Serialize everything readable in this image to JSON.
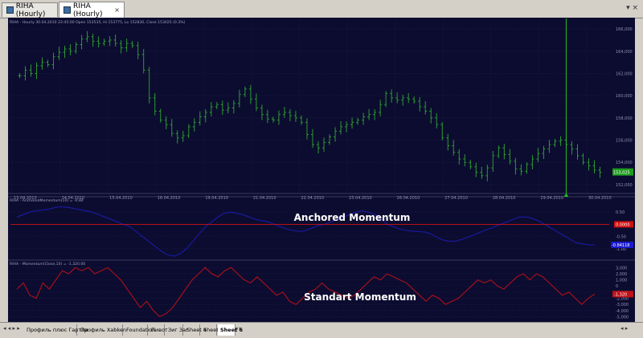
{
  "tabs": [
    {
      "label": "RIHA (Hourly)",
      "active": false
    },
    {
      "label": "RIHA (Hourly)",
      "active": true
    }
  ],
  "window_controls": "▾ ×",
  "colors": {
    "background": "#0c0c30",
    "grid": "#1e2450",
    "price_bar": "#2fa82f",
    "momentum_anchored": "#1a1aa8",
    "momentum_standard": "#b01018",
    "zero_line": "#d01010",
    "cursor_line": "#22c022",
    "axis_text": "#9090b0"
  },
  "chart_data": [
    {
      "type": "line",
      "title": "RIHA - Hourly 30.04.2010 23:45:00 Open 153535, Hi 153775, Lo 152830, Close 153025 (0.3%)",
      "xlabel": "",
      "ylabel": "",
      "x_ticks": [
        "13.04.2010",
        "14.04.2010",
        "15.04.2010",
        "16.04.2010",
        "19.04.2010",
        "21.04.2010",
        "22.04.2010",
        "23.04.2010",
        "26.04.2010",
        "27.04.2010",
        "28.04.2010",
        "29.04.2010",
        "30.04.2010"
      ],
      "y_ticks": [
        152000,
        154000,
        156000,
        158000,
        160000,
        162000,
        164000,
        166000
      ],
      "y_tick_labels": [
        "152,000",
        "154,000",
        "156,000",
        "158,000",
        "160,000",
        "162,000",
        "164,000",
        "166,000"
      ],
      "ylim": [
        151200,
        166800
      ],
      "series": [
        {
          "values": [
            161800,
            162300,
            162000,
            162700,
            163000,
            162800,
            163500,
            163900,
            164200,
            164000,
            164600,
            165100,
            165300,
            164900,
            164700,
            164900,
            165000,
            164700,
            164300,
            164700,
            164500,
            163700,
            162300,
            159800,
            158600,
            157800,
            157400,
            156600,
            156200,
            156400,
            157200,
            157600,
            158100,
            158500,
            159000,
            159200,
            158700,
            158900,
            159300,
            160100,
            160600,
            159700,
            158900,
            158300,
            157900,
            157800,
            158300,
            158500,
            158200,
            158000,
            157600,
            156500,
            155600,
            155300,
            155800,
            156300,
            156800,
            157200,
            157400,
            157600,
            157800,
            158100,
            158300,
            158500,
            159200,
            160200,
            159800,
            159600,
            159800,
            159700,
            159500,
            159000,
            158600,
            158000,
            157400,
            156200,
            155500,
            154900,
            154300,
            154000,
            153600,
            153100,
            152800,
            153500,
            154600,
            155300,
            154700,
            154100,
            153400,
            153200,
            153800,
            154300,
            154800,
            155200,
            155600,
            155900,
            156000,
            155600,
            155200,
            154600,
            154000,
            153700,
            153300,
            153100
          ]
        }
      ],
      "last_label": "153,025",
      "cursor_index": 97
    },
    {
      "type": "line",
      "title": "RIHA - AnchoredMomentum(10) = -0.84",
      "annotation": "Anchored Momentum",
      "y_ticks": [
        -1,
        -0.5,
        0,
        0.5
      ],
      "y_tick_labels": [
        "-1.00",
        "-0.50",
        "0.00",
        "0.50"
      ],
      "ylim": [
        -1.4,
        1.0
      ],
      "zero_label": "0.0000",
      "last_label": "-0.84118",
      "series": [
        {
          "values": [
            0.3,
            0.4,
            0.5,
            0.55,
            0.58,
            0.62,
            0.68,
            0.72,
            0.7,
            0.65,
            0.6,
            0.55,
            0.5,
            0.4,
            0.3,
            0.2,
            0.1,
            0.0,
            -0.1,
            -0.3,
            -0.5,
            -0.7,
            -0.9,
            -1.1,
            -1.25,
            -1.3,
            -1.2,
            -1.0,
            -0.7,
            -0.4,
            -0.1,
            0.1,
            0.3,
            0.45,
            0.5,
            0.45,
            0.4,
            0.3,
            0.2,
            0.15,
            0.1,
            0.0,
            -0.1,
            -0.2,
            -0.25,
            -0.3,
            -0.25,
            -0.15,
            -0.05,
            0.0,
            0.1,
            0.2,
            0.3,
            0.4,
            0.5,
            0.55,
            0.5,
            0.4,
            0.2,
            0.0,
            -0.1,
            -0.2,
            -0.25,
            -0.28,
            -0.3,
            -0.32,
            -0.4,
            -0.55,
            -0.65,
            -0.7,
            -0.68,
            -0.6,
            -0.5,
            -0.4,
            -0.3,
            -0.2,
            -0.1,
            0.0,
            0.1,
            0.2,
            0.3,
            0.3,
            0.25,
            0.15,
            0.0,
            -0.15,
            -0.3,
            -0.45,
            -0.6,
            -0.75,
            -0.8,
            -0.84,
            -0.84
          ]
        }
      ]
    },
    {
      "type": "line",
      "title": "RIHA - Momentum(Close,10) = -1,320.00",
      "annotation": "Standart Momentum",
      "y_ticks": [
        -5000,
        -4000,
        -3000,
        -2000,
        -1000,
        0,
        1000,
        2000,
        3000
      ],
      "y_tick_labels": [
        "-5,000",
        "-4,000",
        "-3,000",
        "-2,000",
        "-1,000",
        "0",
        "1,000",
        "2,000",
        "3,000"
      ],
      "ylim": [
        -5600,
        3700
      ],
      "last_label": "-1,320",
      "series": [
        {
          "values": [
            -500,
            500,
            -1500,
            -2000,
            500,
            -500,
            1000,
            2500,
            2000,
            3000,
            2500,
            3000,
            2000,
            2500,
            3000,
            2000,
            1000,
            -500,
            -2000,
            -3500,
            -2500,
            -4000,
            -5000,
            -4500,
            -3500,
            -2000,
            -500,
            1000,
            2000,
            3000,
            2000,
            1500,
            2500,
            3000,
            2000,
            1000,
            500,
            1500,
            500,
            -500,
            -1500,
            -1000,
            -2500,
            -3000,
            -2000,
            -1000,
            -500,
            500,
            -500,
            -1000,
            -1500,
            -2000,
            -1500,
            -500,
            500,
            1500,
            1000,
            2000,
            1500,
            1000,
            500,
            -500,
            -1500,
            -2500,
            -1500,
            -2000,
            -3000,
            -2500,
            -2000,
            -1000,
            0,
            1000,
            500,
            1000,
            0,
            -500,
            500,
            1500,
            2000,
            1000,
            2000,
            1500,
            500,
            -500,
            -1500,
            -1000,
            -2000,
            -3000,
            -2000,
            -1320
          ]
        }
      ]
    }
  ],
  "bottom_tabs": [
    "Профиль плюс Гартли",
    "Профиль Xabken",
    "Foundation",
    "Пивот",
    "Зиг Заг",
    "Sheet 4",
    "Sheet 1",
    "Sheet 6"
  ],
  "bottom_active": "Sheet 6",
  "nav_left": "◂ ◂ ▸ ▸",
  "nav_mid": "◂ ▸",
  "nav_right": "◂ ▸"
}
